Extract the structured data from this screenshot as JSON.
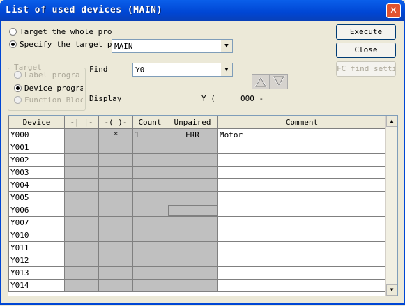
{
  "window": {
    "title": "List of used devices (MAIN)",
    "close": "✕"
  },
  "scope": {
    "whole_label": "Target the whole progr",
    "specify_label": "Specify the target pro",
    "target_program": "MAIN"
  },
  "target_group": {
    "title": "Target",
    "label_program": "Label progra",
    "device_program": "Device progra",
    "function_block": "Function Bloc"
  },
  "find": {
    "label": "Find",
    "value": "Y0"
  },
  "display": {
    "label": "Display",
    "device": "Y (",
    "range": "000 -"
  },
  "buttons": {
    "execute": "Execute",
    "close": "Close",
    "fc_settings": "FC find settin"
  },
  "table": {
    "headers": [
      "Device",
      "-| |-",
      "-( )-",
      "Count",
      "Unpaired",
      "Comment"
    ],
    "rows": [
      [
        "Y000",
        "",
        "*",
        "1",
        "ERR",
        "Motor"
      ],
      [
        "Y001",
        "",
        "",
        "",
        "",
        ""
      ],
      [
        "Y002",
        "",
        "",
        "",
        "",
        ""
      ],
      [
        "Y003",
        "",
        "",
        "",
        "",
        ""
      ],
      [
        "Y004",
        "",
        "",
        "",
        "",
        ""
      ],
      [
        "Y005",
        "",
        "",
        "",
        "",
        ""
      ],
      [
        "Y006",
        "",
        "",
        "",
        "",
        ""
      ],
      [
        "Y007",
        "",
        "",
        "",
        "",
        ""
      ],
      [
        "Y010",
        "",
        "",
        "",
        "",
        ""
      ],
      [
        "Y011",
        "",
        "",
        "",
        "",
        ""
      ],
      [
        "Y012",
        "",
        "",
        "",
        "",
        ""
      ],
      [
        "Y013",
        "",
        "",
        "",
        "",
        ""
      ],
      [
        "Y014",
        "",
        "",
        "",
        "",
        ""
      ]
    ]
  }
}
